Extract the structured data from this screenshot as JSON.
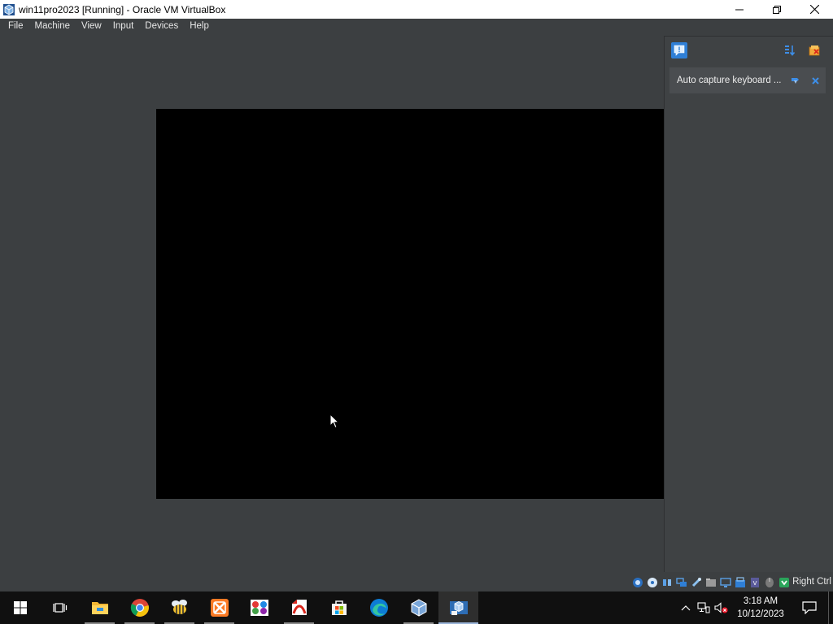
{
  "window": {
    "title": "win11pro2023 [Running] - Oracle VM VirtualBox",
    "icon": "virtualbox-icon",
    "controls": [
      "minimize-icon",
      "maximize-icon",
      "close-icon"
    ]
  },
  "menubar": {
    "items": [
      "File",
      "Machine",
      "View",
      "Input",
      "Devices",
      "Help"
    ]
  },
  "notification_panel": {
    "buttons": [
      "notification-center-icon",
      "sort-icon",
      "clear-all-icon"
    ],
    "items": [
      {
        "text": "Auto capture keyboard ...",
        "icons": [
          "toggle-icon",
          "close-icon"
        ]
      }
    ]
  },
  "statusbar": {
    "icons": [
      "hard-disk-icon",
      "optical-drive-icon",
      "audio-icon",
      "network-icon",
      "usb-icon",
      "shared-folders-icon",
      "display-icon",
      "video-capture-icon",
      "cpu-icon",
      "mouse-integration-icon",
      "keyboard-icon"
    ],
    "host_key": "Right Ctrl"
  },
  "taskbar": {
    "apps": [
      {
        "name": "start-icon",
        "state": "none"
      },
      {
        "name": "task-view-icon",
        "state": "none"
      },
      {
        "name": "file-explorer-icon",
        "state": "open"
      },
      {
        "name": "chrome-icon",
        "state": "open"
      },
      {
        "name": "bee-app-icon",
        "state": "open"
      },
      {
        "name": "xampp-icon",
        "state": "open"
      },
      {
        "name": "paint-app-icon",
        "state": "none"
      },
      {
        "name": "acrobat-icon",
        "state": "open"
      },
      {
        "name": "microsoft-store-icon",
        "state": "none"
      },
      {
        "name": "edge-icon",
        "state": "none"
      },
      {
        "name": "virtualbox-manager-icon",
        "state": "open"
      },
      {
        "name": "virtualbox-vm-icon",
        "state": "active"
      }
    ],
    "tray": {
      "icons": [
        "chevron-up-icon",
        "network-icon",
        "volume-muted-icon"
      ],
      "time": "3:18 AM",
      "date": "10/12/2023"
    }
  },
  "colors": {
    "workspace": "#3c3f41",
    "guest_screen": "#000000",
    "taskbar": "#101010",
    "accent": "#1e90ff"
  }
}
